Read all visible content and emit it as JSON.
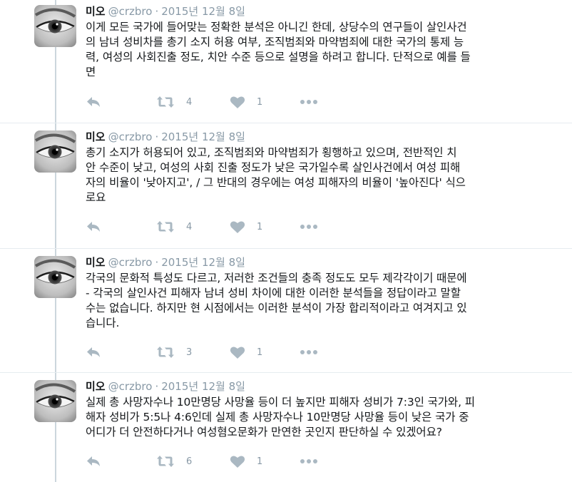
{
  "author": {
    "name": "미오",
    "handle": "@crzbro"
  },
  "tweets": [
    {
      "date": "2015년 12월 8일",
      "text": "이게 모든 국가에 들어맞는 정확한 분석은 아니긴 한데, 상당수의 연구들이 살인사건\n의 남녀 성비차를 총기 소지 허용 여부, 조직범죄와 마약범죄에 대한 국가의 통제 능\n력, 여성의 사회진출 정도, 치안 수준 등으로 설명을 하려고 합니다. 단적으로 예를 들\n면",
      "retweets": "4",
      "likes": "1"
    },
    {
      "date": "2015년 12월 8일",
      "text": "총기 소지가 허용되어 있고, 조직범죄와 마약범죄가 횡행하고 있으며, 전반적인 치\n안 수준이 낮고, 여성의 사회 진출 정도가 낮은 국가일수록 살인사건에서 여성 피해\n자의 비율이 '낮아지고', / 그 반대의 경우에는 여성 피해자의 비율이 '높아진다' 식으\n로요",
      "retweets": "4",
      "likes": "1"
    },
    {
      "date": "2015년 12월 8일",
      "text": "각국의 문화적 특성도 다르고, 저러한 조건들의 충족 정도도 모두 제각각이기 때문에\n- 각국의 살인사건 피해자 남녀 성비 차이에 대한 이러한 분석들을 정답이라고 말할\n수는 없습니다. 하지만 현 시점에서는 이러한 분석이 가장 합리적이라고 여겨지고 있\n습니다.",
      "retweets": "3",
      "likes": "1"
    },
    {
      "date": "2015년 12월 8일",
      "text": "실제 총 사망자수나 10만명당 사망율 등이 더 높지만 피해자 성비가 7:3인 국가와, 피\n해자 성비가 5:5나 4:6인데 실제 총 사망자수나 10만명당 사망율 등이 낮은 국가 중\n어디가 더 안전하다거나 여성혐오문화가 만연한 곳인지 판단하실 수 있겠어요?",
      "retweets": "6",
      "likes": "1"
    }
  ],
  "icons": {
    "reply": "reply-icon",
    "retweet": "retweet-icon",
    "like": "heart-icon",
    "more": "more-icon"
  },
  "colors": {
    "text": "#14171a",
    "muted": "#8899a6",
    "icon": "#aab8c2",
    "thread_line": "#ccd6dd"
  }
}
